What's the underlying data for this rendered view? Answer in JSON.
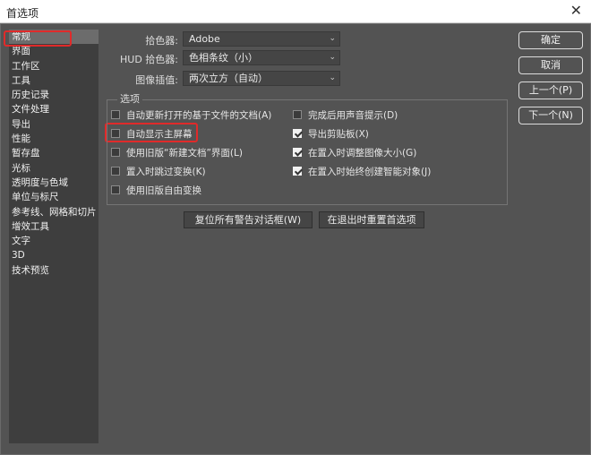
{
  "window": {
    "title": "首选项",
    "close_glyph": "✕"
  },
  "sidebar": {
    "items": [
      "常规",
      "界面",
      "工作区",
      "工具",
      "历史记录",
      "文件处理",
      "导出",
      "性能",
      "暂存盘",
      "光标",
      "透明度与色域",
      "单位与标尺",
      "参考线、网格和切片",
      "增效工具",
      "文字",
      "3D",
      "技术预览"
    ],
    "selected_index": 0
  },
  "general": {
    "color_picker": {
      "label": "拾色器:",
      "value": "Adobe"
    },
    "hud_color_picker": {
      "label": "HUD 拾色器:",
      "value": "色相条纹（小）"
    },
    "image_interpolation": {
      "label": "图像插值:",
      "value": "两次立方（自动）"
    },
    "chevron_glyph": "⌄"
  },
  "options": {
    "title": "选项",
    "left": [
      {
        "label": "自动更新打开的基于文件的文档(A)",
        "checked": false
      },
      {
        "label": "自动显示主屏幕",
        "checked": false
      },
      {
        "label": "使用旧版“新建文档”界面(L)",
        "checked": false
      },
      {
        "label": "置入时跳过变换(K)",
        "checked": false
      },
      {
        "label": "使用旧版自由变换",
        "checked": false
      }
    ],
    "right": [
      {
        "label": "完成后用声音提示(D)",
        "checked": false
      },
      {
        "label": "导出剪贴板(X)",
        "checked": true
      },
      {
        "label": "在置入时调整图像大小(G)",
        "checked": true
      },
      {
        "label": "在置入时始终创建智能对象(J)",
        "checked": true
      }
    ]
  },
  "bottom_buttons": {
    "reset_warnings": "复位所有警告对话框(W)",
    "reset_on_quit": "在退出时重置首选项"
  },
  "right_buttons": {
    "ok": "确定",
    "cancel": "取消",
    "prev": "上一个(P)",
    "next": "下一个(N)"
  },
  "colors": {
    "background": "#535353",
    "sidebar": "#3e3e3e",
    "highlight": "#e02a2a"
  }
}
